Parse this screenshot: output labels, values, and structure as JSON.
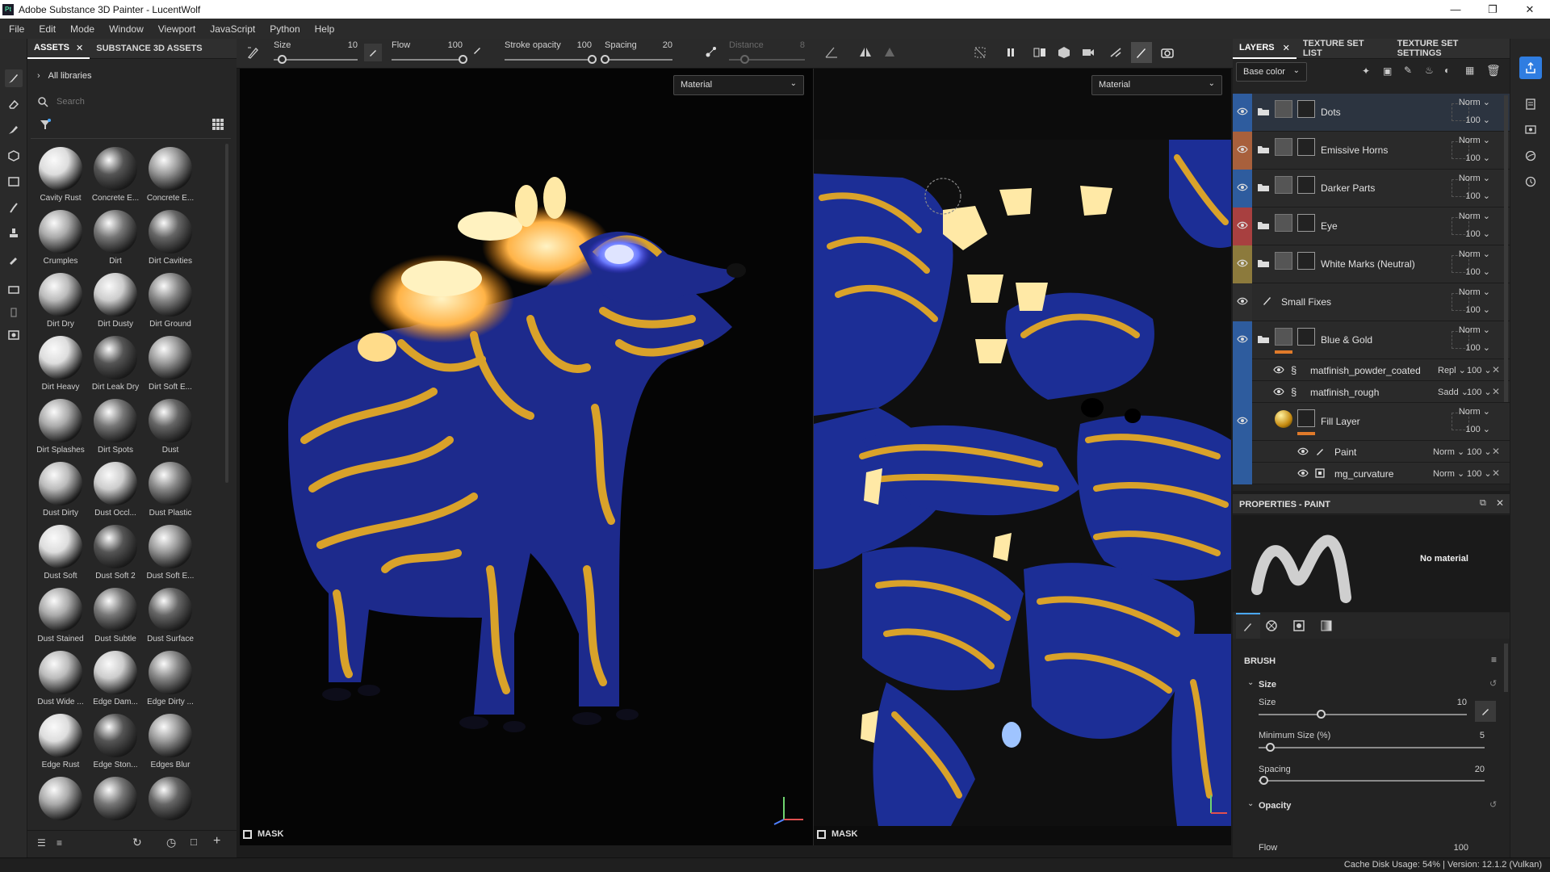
{
  "window": {
    "title": "Adobe Substance 3D Painter - LucentWolf",
    "app_icon": "Pt"
  },
  "menu": [
    "File",
    "Edit",
    "Mode",
    "Window",
    "Viewport",
    "JavaScript",
    "Python",
    "Help"
  ],
  "assets": {
    "tabs": [
      "ASSETS",
      "SUBSTANCE 3D ASSETS"
    ],
    "breadcrumb": "All libraries",
    "search_placeholder": "Search",
    "items": [
      "Cavity Rust",
      "Concrete E...",
      "Concrete E...",
      "Crumples",
      "Dirt",
      "Dirt Cavities",
      "Dirt Dry",
      "Dirt Dusty",
      "Dirt Ground",
      "Dirt Heavy",
      "Dirt Leak Dry",
      "Dirt Soft E...",
      "Dirt Splashes",
      "Dirt Spots",
      "Dust",
      "Dust Dirty",
      "Dust Occl...",
      "Dust Plastic",
      "Dust Soft",
      "Dust Soft 2",
      "Dust Soft E...",
      "Dust Stained",
      "Dust Subtle",
      "Dust Surface",
      "Dust Wide ...",
      "Edge Dam...",
      "Edge Dirty ...",
      "Edge Rust",
      "Edge Ston...",
      "Edges Blur",
      "",
      "",
      ""
    ]
  },
  "toolbar": {
    "size": {
      "label": "Size",
      "value": "10",
      "fraction": 0.1
    },
    "flow": {
      "label": "Flow",
      "value": "100",
      "fraction": 1.0
    },
    "stroke_opacity": {
      "label": "Stroke opacity",
      "value": "100",
      "fraction": 1.0
    },
    "spacing": {
      "label": "Spacing",
      "value": "20",
      "fraction": 0.0
    },
    "distance": {
      "label": "Distance",
      "value": "8",
      "fraction": 0.2
    }
  },
  "viewport3d": {
    "mode": "Material",
    "mask_label": "MASK"
  },
  "viewport2d": {
    "mode": "Material",
    "mask_label": "MASK"
  },
  "layers": {
    "tabs": [
      "LAYERS",
      "TEXTURE SET LIST",
      "TEXTURE SET SETTINGS"
    ],
    "channel": "Base color",
    "rows": [
      {
        "name": "Dots",
        "blend": "Norm",
        "opacity": "100",
        "color": "#2e5c9e",
        "type": "folder"
      },
      {
        "name": "Emissive Horns",
        "blend": "Norm",
        "opacity": "100",
        "color": "#a8603c",
        "type": "folder"
      },
      {
        "name": "Darker Parts",
        "blend": "Norm",
        "opacity": "100",
        "color": "#2e5c9e",
        "type": "folder"
      },
      {
        "name": "Eye",
        "blend": "Norm",
        "opacity": "100",
        "color": "#a84040",
        "type": "folder"
      },
      {
        "name": "White Marks (Neutral)",
        "blend": "Norm",
        "opacity": "100",
        "color": "#8c7a3c",
        "type": "folder"
      },
      {
        "name": "Small Fixes",
        "blend": "Norm",
        "opacity": "100",
        "color": "#2e2e2e",
        "type": "paint"
      },
      {
        "name": "Blue & Gold",
        "blend": "Norm",
        "opacity": "100",
        "color": "#2e5c9e",
        "type": "folder-open"
      }
    ],
    "effects": [
      {
        "name": "matfinish_powder_coated",
        "blend": "Repl",
        "opacity": "100"
      },
      {
        "name": "matfinish_rough",
        "blend": "Sadd",
        "opacity": "100"
      }
    ],
    "fill": {
      "name": "Fill Layer",
      "blend": "Norm",
      "opacity": "100"
    },
    "subeffects": [
      {
        "name": "Paint",
        "blend": "Norm",
        "opacity": "100"
      },
      {
        "name": "mg_curvature",
        "blend": "Norm",
        "opacity": "100"
      }
    ]
  },
  "properties": {
    "title": "PROPERTIES - PAINT",
    "material_text": "No material",
    "section": "BRUSH",
    "group_size": "Size",
    "size": {
      "label": "Size",
      "value": "10",
      "fraction": 0.3
    },
    "min_size": {
      "label": "Minimum Size (%)",
      "value": "5",
      "fraction": 0.05
    },
    "spacing": {
      "label": "Spacing",
      "value": "20",
      "fraction": 0.02
    },
    "group_opacity": "Opacity",
    "flow": {
      "label": "Flow",
      "value": "100"
    }
  },
  "status": {
    "text": "Cache Disk Usage:   54% | Version: 12.1.2 (Vulkan)"
  }
}
